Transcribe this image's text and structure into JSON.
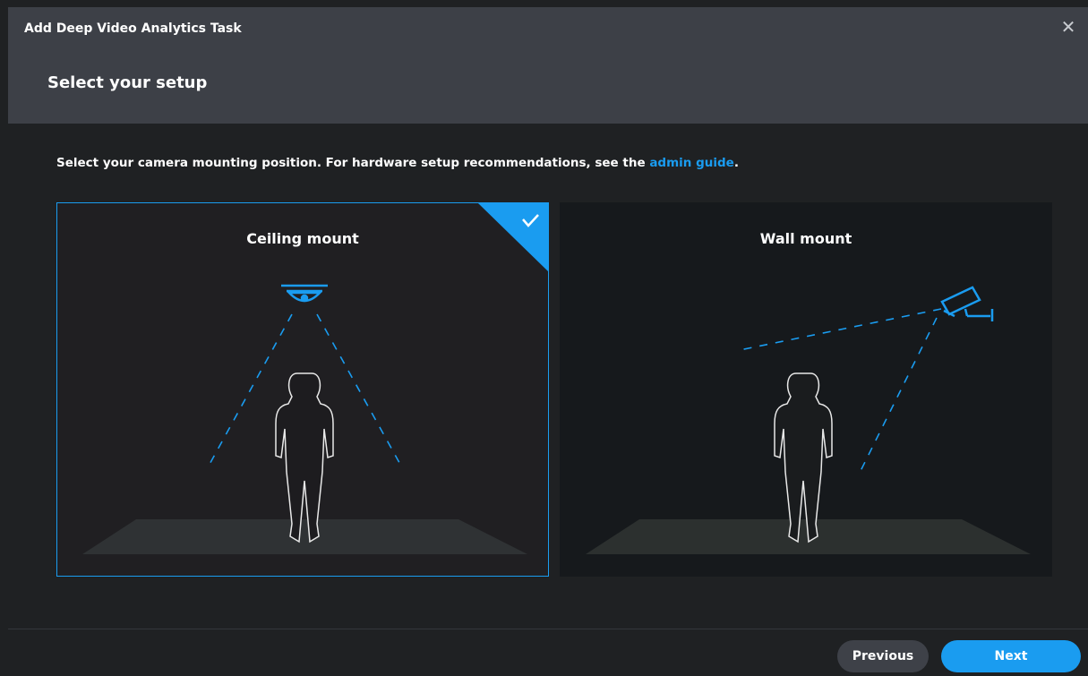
{
  "dialog": {
    "title": "Add Deep Video Analytics Task",
    "close_icon": "close-icon",
    "step_title": "Select your setup"
  },
  "instructions": {
    "text_before": "Select your camera mounting position. For hardware setup recommendations, see the ",
    "link_text": "admin guide",
    "text_after": "."
  },
  "options": {
    "ceiling": {
      "label": "Ceiling mount",
      "selected": true,
      "icon": "ceiling-camera-icon"
    },
    "wall": {
      "label": "Wall mount",
      "selected": false,
      "icon": "wall-camera-icon"
    }
  },
  "footer": {
    "previous_label": "Previous",
    "next_label": "Next"
  },
  "colors": {
    "accent": "#1a9cf0",
    "header_bg": "#3d4047",
    "body_bg": "#1f2123"
  }
}
